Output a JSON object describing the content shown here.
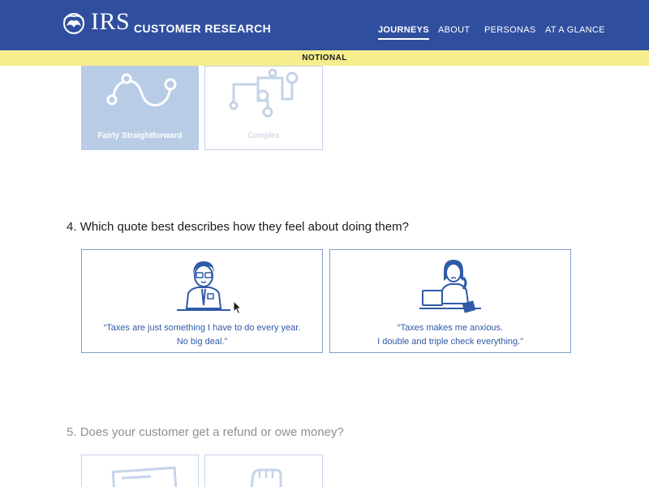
{
  "header": {
    "logo_text": "IRS",
    "site_title": "CUSTOMER RESEARCH",
    "nav": [
      {
        "label": "JOURNEYS",
        "active": true
      },
      {
        "label": "ABOUT",
        "active": false
      },
      {
        "label": "PERSONAS",
        "active": false
      },
      {
        "label": "AT A GLANCE",
        "active": false
      }
    ]
  },
  "banner": {
    "label": "NOTIONAL"
  },
  "complexity_options": [
    {
      "label": "Fairly Straightforward",
      "selected": true,
      "icon": "curvy-path-icon"
    },
    {
      "label": "Complex",
      "selected": false,
      "icon": "branching-path-icon"
    }
  ],
  "question4": {
    "number": "4.",
    "text": "Which quote best describes how they feel about doing them?",
    "options": [
      {
        "line1": "“Taxes are just something I have to do every year.",
        "line2": "No big deal.”",
        "icon": "calm-man-at-desk-icon"
      },
      {
        "line1": "“Taxes makes me anxious.",
        "line2": "I double and triple check everything.”",
        "icon": "anxious-woman-with-laptop-icon"
      }
    ]
  },
  "question5": {
    "number": "5.",
    "text": "Does your customer get a refund or owe money?",
    "options": [
      {
        "icon": "check-icon"
      },
      {
        "icon": "hand-with-money-icon"
      }
    ]
  },
  "colors": {
    "header": "#2f4f9e",
    "banner": "#f6ee8d",
    "selected_card": "#b9cce6",
    "accent_text": "#2f5aa7"
  }
}
